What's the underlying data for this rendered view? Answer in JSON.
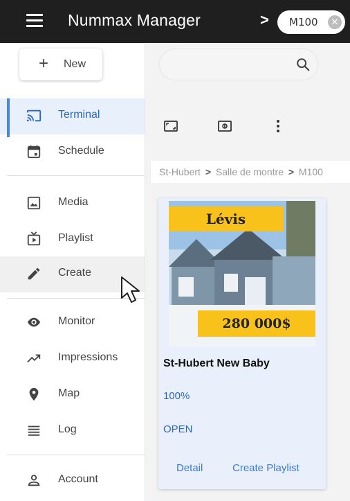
{
  "app": {
    "title": "Nummax Manager",
    "breadcrumb_chevron": ">",
    "chip_label": "M100",
    "chip_close": "✕"
  },
  "sidebar": {
    "new_button": {
      "icon": "+",
      "label": "New"
    },
    "items": [
      {
        "label": "Terminal",
        "icon": "cast-icon",
        "active": true
      },
      {
        "label": "Schedule",
        "icon": "calendar-icon"
      },
      {
        "label": "Media",
        "icon": "image-icon"
      },
      {
        "label": "Playlist",
        "icon": "tv-play-icon"
      },
      {
        "label": "Create",
        "icon": "pencil-icon"
      },
      {
        "label": "Monitor",
        "icon": "eye-icon"
      },
      {
        "label": "Impressions",
        "icon": "trending-up-icon"
      },
      {
        "label": "Map",
        "icon": "map-pin-icon"
      },
      {
        "label": "Log",
        "icon": "list-icon"
      },
      {
        "label": "Account",
        "icon": "person-icon"
      }
    ]
  },
  "main": {
    "search": {
      "placeholder": "",
      "value": ""
    },
    "toolbar": [
      "fullscreen-icon",
      "screenshot-icon",
      "more-vert-icon"
    ],
    "breadcrumb": [
      "St-Hubert",
      "Salle de montre",
      "M100"
    ],
    "breadcrumb_sep": ">",
    "card": {
      "image_banner_top": "Lévis",
      "image_banner_price": "280 000$",
      "title": "St-Hubert New Baby",
      "percent": "100%",
      "status": "OPEN",
      "link_detail": "Detail",
      "link_create_playlist": "Create Playlist"
    }
  },
  "colors": {
    "topbar": "#1f1f1f",
    "accent": "#2b66c5",
    "active_bg": "#e8f0fc",
    "banner": "#f8c21b"
  }
}
